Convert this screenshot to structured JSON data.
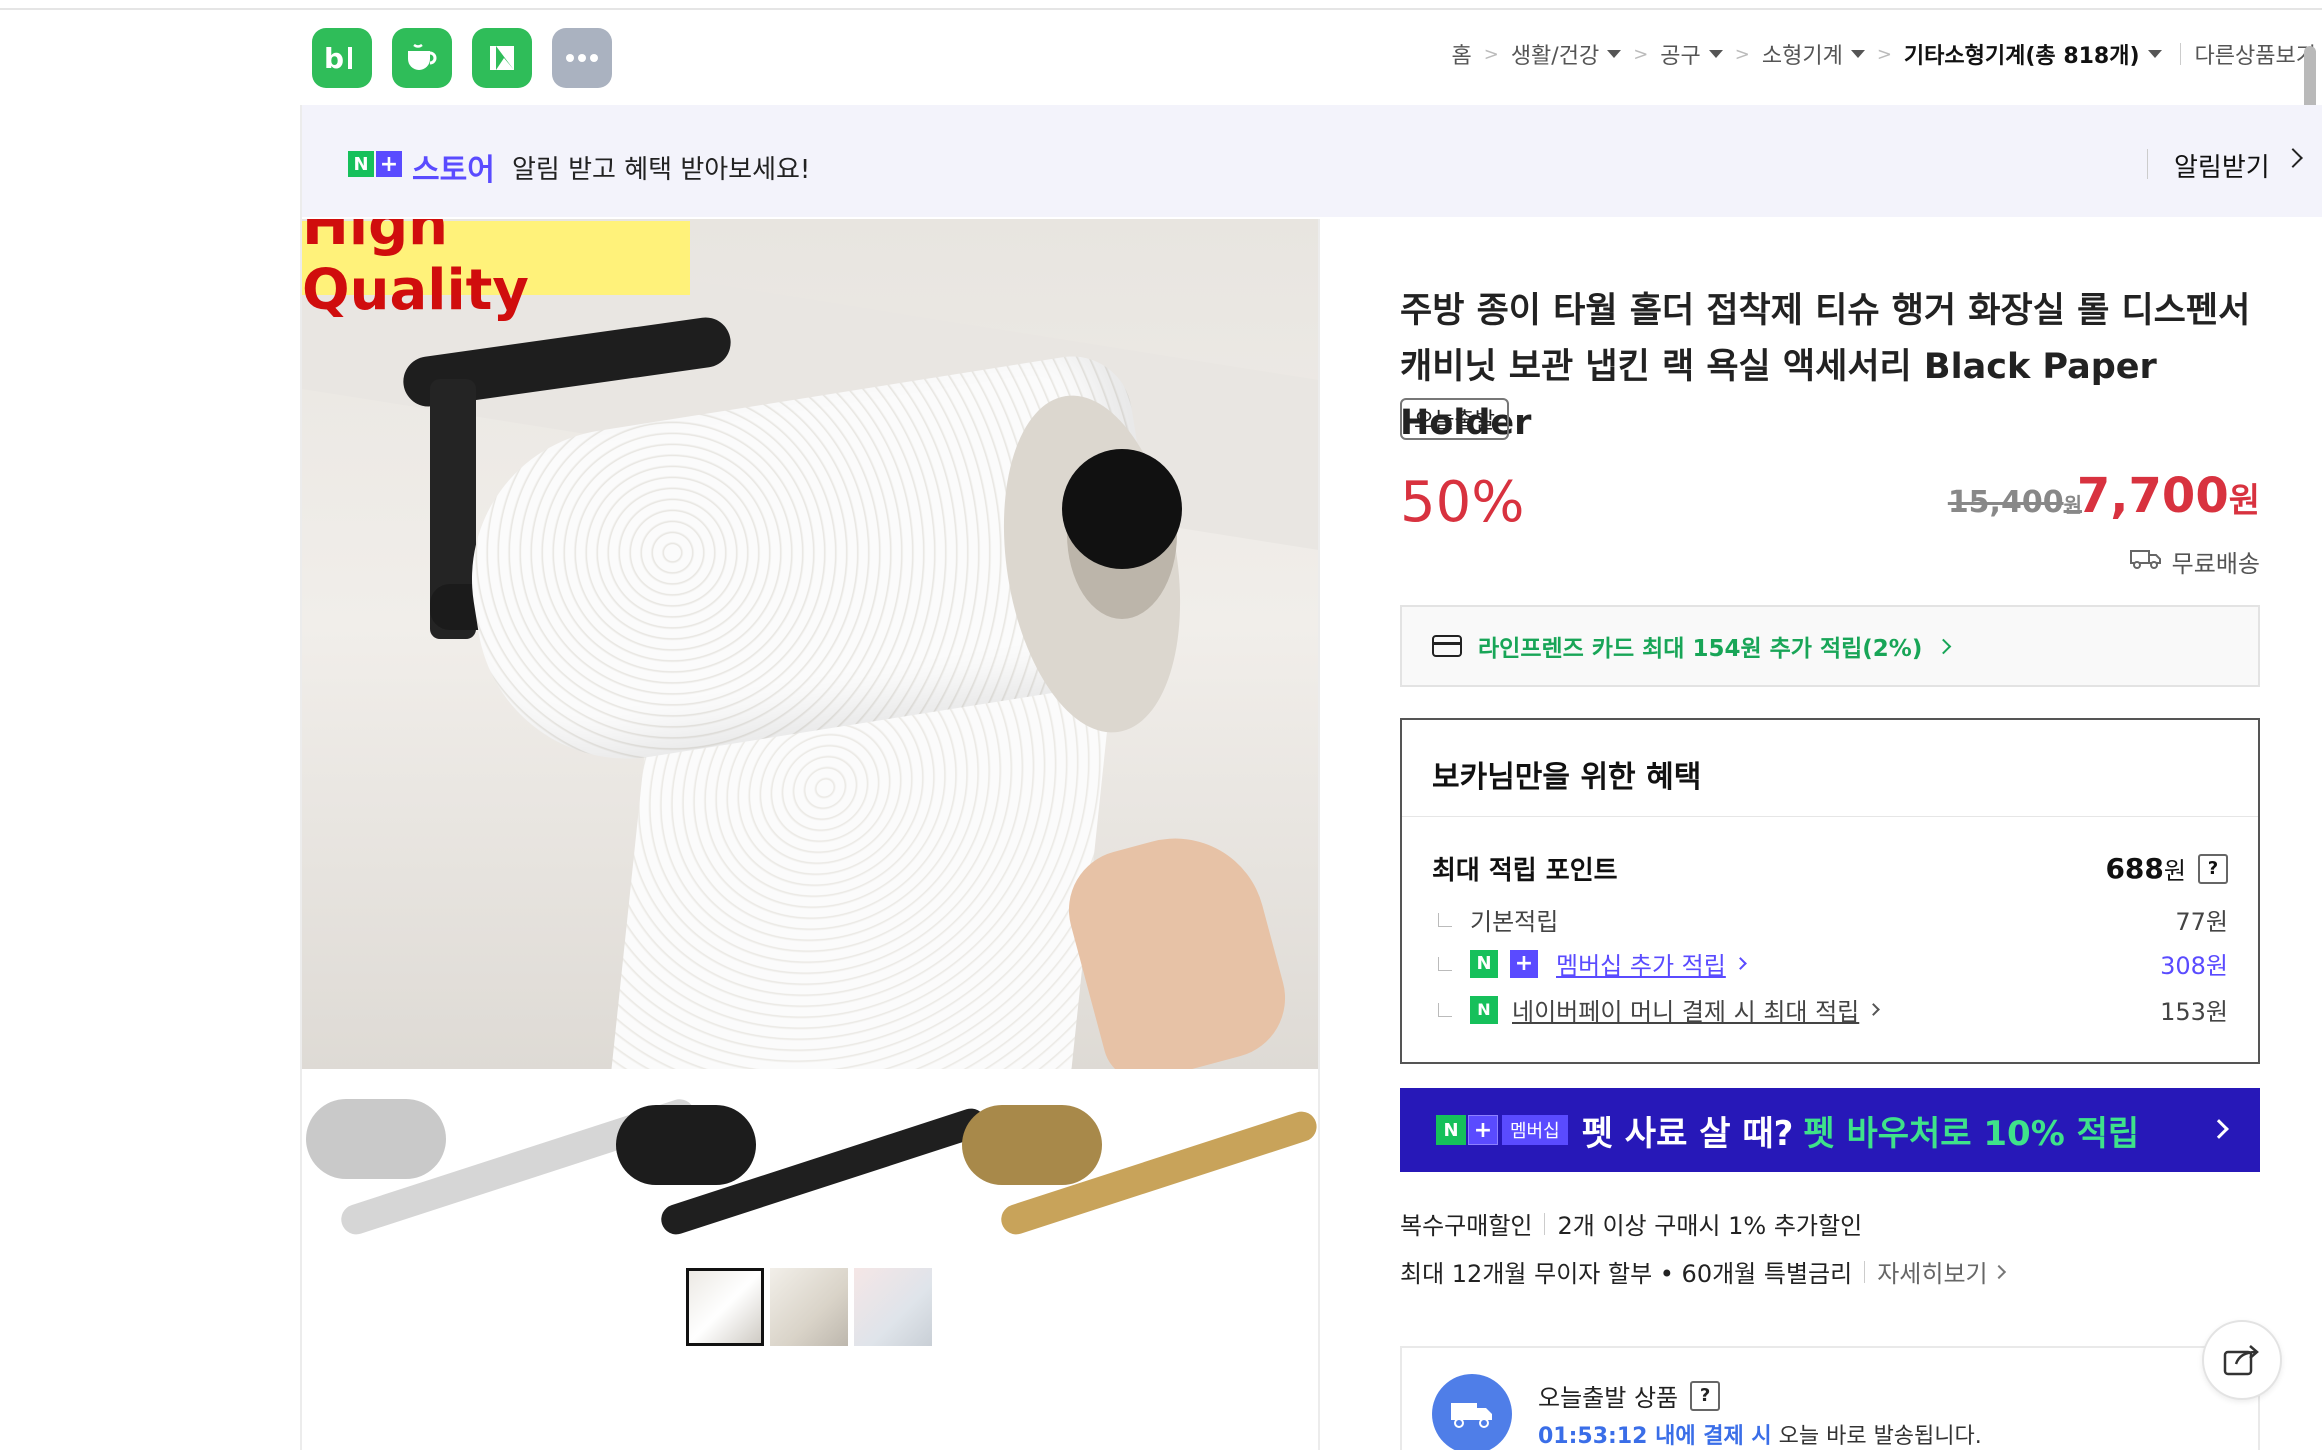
{
  "header": {
    "apps": [
      {
        "label": "b|",
        "icon": "blog-icon"
      },
      {
        "label": "cup",
        "icon": "cafe-icon"
      },
      {
        "label": "flag",
        "icon": "bookmark-icon"
      },
      {
        "label": "•••",
        "icon": "more-icon"
      }
    ],
    "breadcrumb": {
      "home": "홈",
      "cat1": "생활/건강",
      "cat2": "공구",
      "cat3": "소형기계",
      "cat4": "기타소형기계(총 818개)",
      "other": "다른상품보기"
    }
  },
  "banner": {
    "n": "N",
    "plus": "+",
    "store": "스토어",
    "message": "알림 받고 혜택 받아보세요!",
    "action": "알림받기"
  },
  "image": {
    "badge": "High Quality"
  },
  "product": {
    "title": "주방 종이 타월 홀더 접착제 티슈 행거 화장실 롤 디스펜서 캐비닛 보관 냅킨 랙 욕실 액세서리 Black Paper Holder",
    "tag": "오늘출발",
    "discount": "50%",
    "original_price": "15,400",
    "original_unit": "원",
    "price": "7,700",
    "price_unit": "원",
    "shipping": "무료배송"
  },
  "card": {
    "text": "라인프렌즈 카드 최대 154원 추가 적립(2%)"
  },
  "benefit": {
    "title": "보카님만을 위한 혜택",
    "max_label": "최대 적립 포인트",
    "max_value": "688",
    "max_unit": "원",
    "help": "?",
    "rows": [
      {
        "label": "기본적립",
        "value": "77원"
      },
      {
        "label": "멤버십 추가 적립",
        "value": "308원"
      },
      {
        "label": "네이버페이 머니 결제 시 최대 적립",
        "value": "153원"
      }
    ]
  },
  "promo": {
    "membership": "멤버십",
    "text1": "펫 사료 살 때?",
    "text2": "펫 바우처로 10% 적립"
  },
  "discounts": {
    "multi_label": "복수구매할인",
    "multi_text": "2개 이상 구매시 1% 추가할인",
    "install_text": "최대 12개월 무이자 할부 • 60개월 특별금리",
    "install_more": "자세히보기"
  },
  "today": {
    "title": "오늘출발 상품",
    "timer": "01:53:12 내에 결제 시",
    "tail": "오늘 바로 발송됩니다."
  },
  "colors": {
    "accent_red": "#d8323f",
    "naver_green": "#16c05b",
    "store_purple": "#5a4bff",
    "promo_blue": "#2718b8"
  }
}
